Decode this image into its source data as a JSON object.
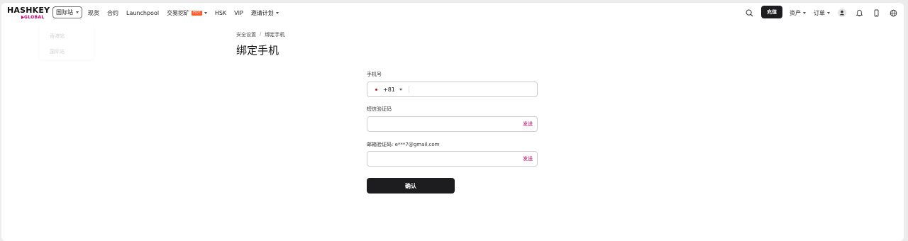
{
  "header": {
    "logo_top": "HASHKEY",
    "logo_bottom": "GLOBAL",
    "site_selector": "国际站",
    "nav": [
      {
        "label": "现货"
      },
      {
        "label": "合约"
      },
      {
        "label": "Launchpool"
      },
      {
        "label": "交易挖矿",
        "badge": "HOT"
      },
      {
        "label": "HSK"
      },
      {
        "label": "VIP"
      },
      {
        "label": "邀请计划"
      }
    ],
    "deposit_label": "充值",
    "assets_label": "资产",
    "orders_label": "订单"
  },
  "site_dropdown": {
    "options": [
      "香港站",
      "国际站"
    ]
  },
  "breadcrumb": {
    "parent": "安全设置",
    "separator": "/",
    "current": "绑定手机"
  },
  "page_title": "绑定手机",
  "form": {
    "phone_label": "手机号",
    "country_code": "+81",
    "phone_value": "",
    "sms_label": "短信验证码",
    "sms_value": "",
    "sms_send": "发送",
    "email_label": "邮箱验证码: e***7@gmail.com",
    "email_value": "",
    "email_send": "发送",
    "confirm_label": "确认"
  },
  "colors": {
    "brand": "#c8006e",
    "primary_button": "#1d1d1f",
    "hot_badge": "#ff5a2a"
  }
}
